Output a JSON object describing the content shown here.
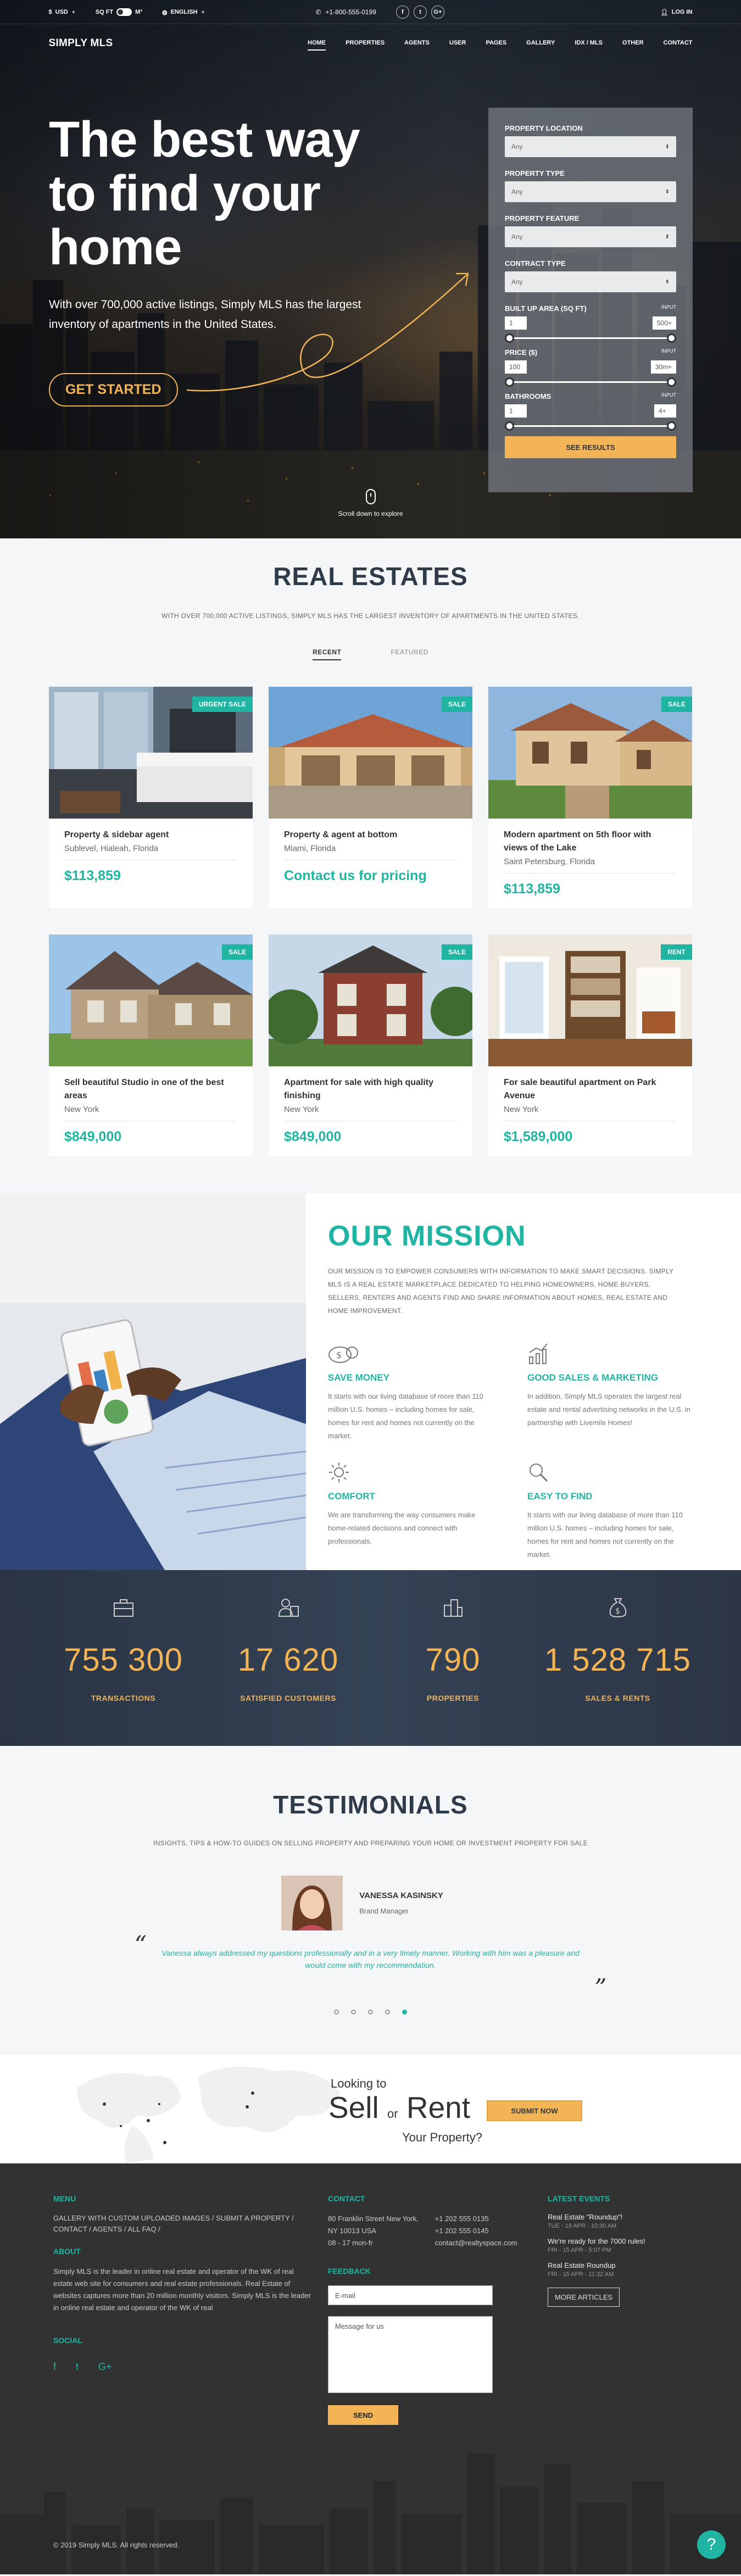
{
  "topbar": {
    "currency": "USD",
    "unit_left": "SQ FT",
    "unit_right": "M²",
    "language": "ENGLISH",
    "phone": "+1-800-555-0199",
    "social": [
      "f",
      "t",
      "G+"
    ],
    "login": "LOG IN"
  },
  "nav": {
    "logo": "SIMPLY MLS",
    "items": [
      "HOME",
      "PROPERTIES",
      "AGENTS",
      "USER",
      "PAGES",
      "GALLERY",
      "IDX / MLS",
      "OTHER",
      "CONTACT"
    ]
  },
  "hero": {
    "title": "The best way to find your home",
    "subtitle": "With over 700,000 active listings, Simply MLS has the largest inventory of apartments in the United States.",
    "cta": "GET STARTED",
    "scroll": "Scroll down to explore"
  },
  "search": {
    "fields": [
      {
        "label": "PROPERTY LOCATION",
        "value": "Any"
      },
      {
        "label": "PROPERTY TYPE",
        "value": "Any"
      },
      {
        "label": "PROPERTY FEATURE",
        "value": "Any"
      },
      {
        "label": "CONTRACT TYPE",
        "value": "Any"
      }
    ],
    "ranges": [
      {
        "label": "BUILT UP AREA (SQ FT)",
        "input": "INPUT",
        "min": "1",
        "max": "500+"
      },
      {
        "label": "PRICE ($)",
        "input": "INPUT",
        "min": "100",
        "max": "30m+"
      },
      {
        "label": "BATHROOMS",
        "input": "INPUT",
        "min": "1",
        "max": "4+"
      }
    ],
    "button": "SEE RESULTS"
  },
  "estates": {
    "title": "REAL ESTATES",
    "subtitle": "WITH OVER 700,000 ACTIVE LISTINGS, SIMPLY MLS HAS THE LARGEST INVENTORY OF APARTMENTS IN THE UNITED STATES.",
    "tabs": [
      "RECENT",
      "FEATURED"
    ],
    "cards": [
      {
        "badge": "URGENT SALE",
        "title": "Property & sidebar agent",
        "location": "Sublevel, Hialeah, Florida",
        "price": "$113,859"
      },
      {
        "badge": "SALE",
        "title": "Property & agent at bottom",
        "location": "Miami, Florida",
        "price": "Contact us for pricing"
      },
      {
        "badge": "SALE",
        "title": "Modern apartment on 5th floor with views of the Lake",
        "location": "Saint Petersburg, Florida",
        "price": "$113,859"
      },
      {
        "badge": "SALE",
        "title": "Sell beautiful Studio in one of the best areas",
        "location": "New York",
        "price": "$849,000"
      },
      {
        "badge": "SALE",
        "title": "Apartment for sale with high quality finishing",
        "location": "New York",
        "price": "$849,000"
      },
      {
        "badge": "RENT",
        "title": "For sale beautiful apartment on Park Avenue",
        "location": "New York",
        "price": "$1,589,000"
      }
    ]
  },
  "mission": {
    "title": "OUR MISSION",
    "description": "OUR MISSION IS TO EMPOWER CONSUMERS WITH INFORMATION TO MAKE SMART DECISIONS. SIMPLY MLS IS A REAL ESTATE MARKETPLACE DEDICATED TO HELPING HOMEOWNERS, HOME BUYERS, SELLERS, RENTERS AND AGENTS FIND AND SHARE INFORMATION ABOUT HOMES, REAL ESTATE AND HOME IMPROVEMENT.",
    "features": [
      {
        "title": "SAVE MONEY",
        "text": "It starts with our living database of more than 110 million U.S. homes – including homes for sale, homes for rent and homes not currently on the market."
      },
      {
        "title": "GOOD SALES & MARKETING",
        "text": "In addition, Simply MLS operates the largest real estate and rental advertising networks in the U.S. in partnership with Livemile Homes!"
      },
      {
        "title": "COMFORT",
        "text": "We are transforming the way consumers make home-related decisions and connect with professionals."
      },
      {
        "title": "EASY TO FIND",
        "text": "It starts with our living database of more than 110 million U.S. homes – including homes for sale, homes for rent and homes not currently on the market."
      }
    ]
  },
  "stats": [
    {
      "value": "755 300",
      "label": "TRANSACTIONS"
    },
    {
      "value": "17 620",
      "label": "SATISFIED CUSTOMERS"
    },
    {
      "value": "790",
      "label": "PROPERTIES"
    },
    {
      "value": "1 528 715",
      "label": "SALES & RENTS"
    }
  ],
  "testimonials": {
    "title": "TESTIMONIALS",
    "subtitle": "INSIGHTS, TIPS & HOW-TO GUIDES ON SELLING PROPERTY AND PREPARING YOUR HOME OR INVESTMENT PROPERTY FOR SALE",
    "name": "VANESSA KASINSKY",
    "role": "Brand Manager",
    "quote": "Vanessa always addressed my questions professionally and in a very timely manner. Working with him was a pleasure and would come with my recommendation.",
    "open_quote": "“",
    "close_quote": "”"
  },
  "banner": {
    "line1": "Looking to",
    "sell": "Sell",
    "or": "or",
    "rent": "Rent",
    "line3": "Your Property?",
    "button": "SUBMIT NOW"
  },
  "footer": {
    "menu_head": "MENU",
    "menu_lines": [
      "GALLERY WITH CUSTOM UPLOADED IMAGES  /  SUBMIT A PROPERTY  /",
      "CONTACT  /  AGENTS  /  ALL FAQ  /"
    ],
    "about_head": "ABOUT",
    "about_text": "Simply MLS is the leader in online real estate and operator of the WK of real estate web site for consumers and real estate professionals. Real Estate of websites captures more than 20 million monthly visitors. Simply MLS is the leader in online real estate and operator of the WK of real",
    "social_head": "SOCIAL",
    "social": [
      "f",
      "t",
      "G+"
    ],
    "contact_head": "CONTACT",
    "address": [
      "80 Franklin Street New York,",
      "NY 10013 USA",
      "08 - 17 mon-fr"
    ],
    "phones": [
      "+1 202 555 0135",
      "+1 202 555 0145",
      "contact@realtyspace.com"
    ],
    "feedback_head": "FEEDBACK",
    "email_placeholder": "E-mail",
    "message_placeholder": "Message for us",
    "send": "SEND",
    "events_head": "LATEST EVENTS",
    "events": [
      {
        "title": "Real Estate \"Roundup\"!",
        "date": "TUE - 19 APR - 10:30 AM"
      },
      {
        "title": "We're ready for the 7000 rules!",
        "date": "FRI - 15 APR - 5:07 PM"
      },
      {
        "title": "Real Estate Roundup",
        "date": "FRI - 15 APR - 11:32 AM"
      }
    ],
    "more": "MORE ARTICLES",
    "copyright": "© 2019 Simply MLS. All rights reserved.",
    "help": "?"
  }
}
